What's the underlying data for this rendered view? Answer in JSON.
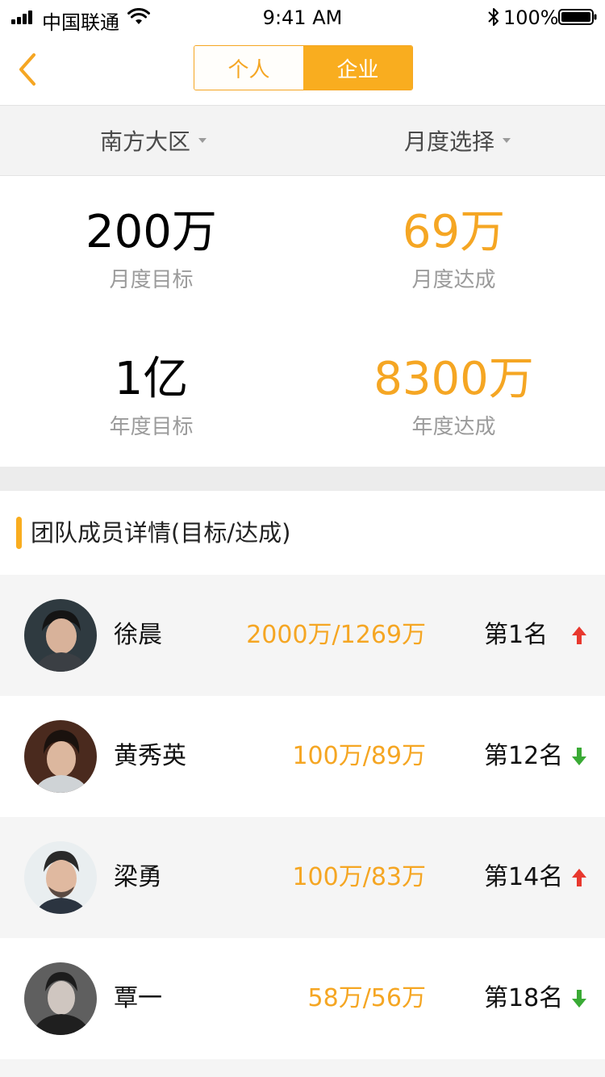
{
  "status_bar": {
    "carrier": "中国联通",
    "time": "9:41 AM",
    "battery": "100%"
  },
  "nav": {
    "back_icon": "chevron-left-icon",
    "tabs": [
      {
        "label": "个人",
        "active": false
      },
      {
        "label": "企业",
        "active": true
      }
    ]
  },
  "filters": {
    "region": "南方大区",
    "period": "月度选择"
  },
  "stats": {
    "monthly_target": {
      "value": "200万",
      "label": "月度目标"
    },
    "monthly_achieved": {
      "value": "69万",
      "label": "月度达成"
    },
    "annual_target": {
      "value": "1亿",
      "label": "年度目标"
    },
    "annual_achieved": {
      "value": "8300万",
      "label": "年度达成"
    }
  },
  "section": {
    "title": "团队成员详情(目标/达成)"
  },
  "members": [
    {
      "name": "徐晨",
      "amount": "2000万/1269万",
      "rank": "第1名",
      "trend": "up"
    },
    {
      "name": "黄秀英",
      "amount": "100万/89万",
      "rank": "第12名",
      "trend": "down"
    },
    {
      "name": "梁勇",
      "amount": "100万/83万",
      "rank": "第14名",
      "trend": "up"
    },
    {
      "name": "覃一",
      "amount": "58万/56万",
      "rank": "第18名",
      "trend": "down"
    }
  ],
  "colors": {
    "accent": "#f9ad1f",
    "accent_text": "#f5a623",
    "up": "#e8382e",
    "down": "#3aaa35",
    "muted_text": "#9b9b9b"
  }
}
